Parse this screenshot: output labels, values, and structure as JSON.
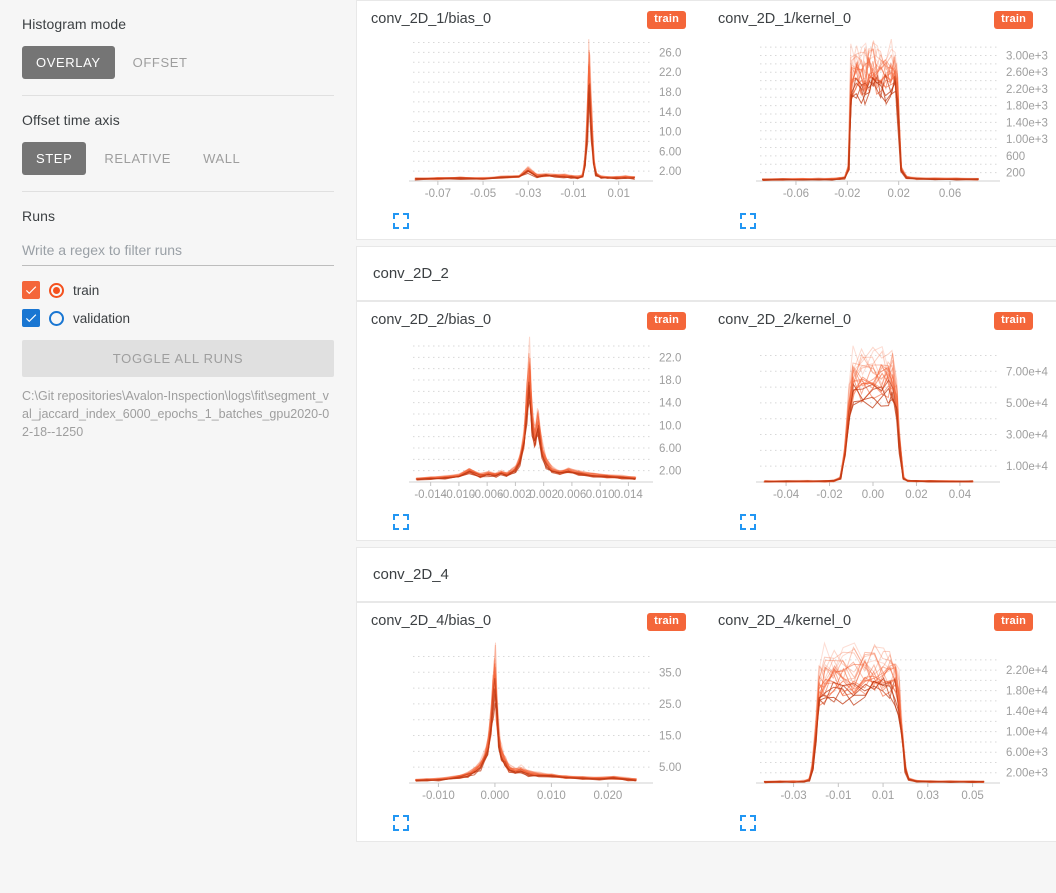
{
  "sidebar": {
    "histogram_mode": {
      "label": "Histogram mode",
      "options": [
        "OVERLAY",
        "OFFSET"
      ],
      "selected": "OVERLAY"
    },
    "offset_time_axis": {
      "label": "Offset time axis",
      "options": [
        "STEP",
        "RELATIVE",
        "WALL"
      ],
      "selected": "STEP"
    },
    "runs": {
      "label": "Runs",
      "filter_placeholder": "Write a regex to filter runs",
      "filter_value": "",
      "items": [
        {
          "name": "train",
          "checked": true,
          "color": "#f4663a",
          "selected": true
        },
        {
          "name": "validation",
          "checked": true,
          "color": "#1976d2",
          "selected": false
        }
      ],
      "toggle_all_label": "TOGGLE ALL RUNS",
      "logdir": "C:\\Git repositories\\Avalon-Inspection\\logs\\fit\\segment_val_jaccard_index_6000_epochs_1_batches_gpu2020-02-18--1250"
    }
  },
  "colors": {
    "accent_orange": "#f4663a",
    "accent_blue": "#1976d2",
    "active_button": "#757575",
    "grid": "#d8d8d8"
  },
  "main": {
    "groups": [
      {
        "header": null,
        "charts": [
          {
            "title": "conv_2D_1/bias_0",
            "badge": "train",
            "expand_icon": "fullscreen-icon",
            "chart_data": {
              "type": "line",
              "title": "conv_2D_1/bias_0",
              "xlabel": "",
              "ylabel": "",
              "grid": true,
              "legend": [
                "train"
              ],
              "xticks": [
                "-0.07",
                "-0.05",
                "-0.03",
                "-0.01",
                "0.01"
              ],
              "xtick_values": [
                -0.07,
                -0.05,
                -0.03,
                -0.01,
                0.01
              ],
              "yticks": [
                "2.00",
                "6.00",
                "10.0",
                "14.0",
                "18.0",
                "22.0",
                "26.0"
              ],
              "ytick_values": [
                2,
                6,
                10,
                14,
                18,
                22,
                26
              ],
              "xlim": [
                -0.081,
                0.019
              ],
              "ylim": [
                0,
                27.5
              ],
              "series": [
                {
                  "name": "train",
                  "x": [
                    -0.08,
                    -0.07,
                    -0.06,
                    -0.05,
                    -0.042,
                    -0.034,
                    -0.03,
                    -0.026,
                    -0.022,
                    -0.018,
                    -0.014,
                    -0.011,
                    -0.008,
                    -0.006,
                    -0.005,
                    -0.004,
                    -0.003,
                    -0.002,
                    -0.001,
                    0.0,
                    0.002,
                    0.005,
                    0.009,
                    0.013,
                    0.017
                  ],
                  "values": [
                    0.5,
                    0.6,
                    0.7,
                    0.6,
                    0.9,
                    1.1,
                    2.6,
                    1.2,
                    1.4,
                    1.3,
                    1.2,
                    1.0,
                    0.9,
                    1.2,
                    4.0,
                    12.0,
                    26.8,
                    13.0,
                    4.5,
                    1.6,
                    1.0,
                    0.9,
                    0.8,
                    0.9,
                    0.8
                  ]
                }
              ]
            }
          },
          {
            "title": "conv_2D_1/kernel_0",
            "badge": "train",
            "expand_icon": "fullscreen-icon",
            "chart_data": {
              "type": "line",
              "title": "conv_2D_1/kernel_0",
              "xlabel": "",
              "ylabel": "",
              "grid": true,
              "legend": [
                "train"
              ],
              "xticks": [
                "-0.06",
                "-0.02",
                "0.02",
                "0.06"
              ],
              "xtick_values": [
                -0.06,
                -0.02,
                0.02,
                0.06
              ],
              "yticks": [
                "200",
                "600",
                "1.00e+3",
                "1.40e+3",
                "1.80e+3",
                "2.20e+3",
                "2.60e+3",
                "3.00e+3"
              ],
              "ytick_values": [
                200,
                600,
                1000,
                1400,
                1800,
                2200,
                2600,
                3000
              ],
              "xlim": [
                -0.088,
                0.088
              ],
              "ylim": [
                0,
                3250
              ],
              "series": [
                {
                  "name": "train",
                  "x": [
                    -0.086,
                    -0.07,
                    -0.055,
                    -0.042,
                    -0.032,
                    -0.026,
                    -0.022,
                    -0.019,
                    -0.017,
                    -0.013,
                    -0.009,
                    -0.006,
                    -0.003,
                    0.0,
                    0.003,
                    0.006,
                    0.01,
                    0.014,
                    0.017,
                    0.019,
                    0.022,
                    0.026,
                    0.034,
                    0.048,
                    0.065,
                    0.082
                  ],
                  "values": [
                    40,
                    45,
                    50,
                    55,
                    60,
                    70,
                    90,
                    350,
                    2950,
                    3080,
                    2960,
                    2980,
                    3050,
                    3090,
                    3020,
                    2950,
                    2980,
                    3060,
                    3000,
                    2700,
                    330,
                    100,
                    70,
                    60,
                    55,
                    50
                  ]
                }
              ]
            }
          }
        ]
      },
      {
        "header": "conv_2D_2",
        "charts": [
          {
            "title": "conv_2D_2/bias_0",
            "badge": "train",
            "expand_icon": "fullscreen-icon",
            "chart_data": {
              "type": "line",
              "title": "conv_2D_2/bias_0",
              "xlabel": "",
              "ylabel": "",
              "grid": true,
              "legend": [
                "train"
              ],
              "xticks": [
                "-0.014",
                "-0.010",
                "-0.006",
                "-0.002",
                "0.002",
                "0.006",
                "0.010",
                "0.014"
              ],
              "xtick_values": [
                -0.014,
                -0.01,
                -0.006,
                -0.002,
                0.002,
                0.006,
                0.01,
                0.014
              ],
              "yticks": [
                "2.00",
                "6.00",
                "10.0",
                "14.0",
                "18.0",
                "22.0"
              ],
              "ytick_values": [
                2,
                6,
                10,
                14,
                18,
                22
              ],
              "xlim": [
                -0.0165,
                0.0155
              ],
              "ylim": [
                0,
                24
              ],
              "series": [
                {
                  "name": "train",
                  "x": [
                    -0.016,
                    -0.014,
                    -0.012,
                    -0.01,
                    -0.0085,
                    -0.007,
                    -0.0058,
                    -0.0048,
                    -0.004,
                    -0.0032,
                    -0.0026,
                    -0.002,
                    -0.0014,
                    -0.0008,
                    -0.0004,
                    0.0,
                    0.0004,
                    0.0008,
                    0.0012,
                    0.0018,
                    0.0024,
                    0.0032,
                    0.0042,
                    0.0055,
                    0.007,
                    0.009,
                    0.011,
                    0.013,
                    0.015
                  ],
                  "values": [
                    0.6,
                    0.8,
                    1.0,
                    1.3,
                    2.4,
                    1.4,
                    1.7,
                    1.5,
                    1.9,
                    1.6,
                    2.1,
                    2.6,
                    4.5,
                    9.0,
                    16.0,
                    23.0,
                    12.0,
                    9.5,
                    12.5,
                    6.5,
                    4.0,
                    2.6,
                    2.0,
                    2.4,
                    1.8,
                    1.4,
                    1.2,
                    1.0,
                    0.8
                  ]
                }
              ]
            }
          },
          {
            "title": "conv_2D_2/kernel_0",
            "badge": "train",
            "expand_icon": "fullscreen-icon",
            "chart_data": {
              "type": "line",
              "title": "conv_2D_2/kernel_0",
              "xlabel": "",
              "ylabel": "",
              "grid": true,
              "legend": [
                "train"
              ],
              "xticks": [
                "-0.04",
                "-0.02",
                "0.00",
                "0.02",
                "0.04"
              ],
              "xtick_values": [
                -0.04,
                -0.02,
                0.0,
                0.02,
                0.04
              ],
              "yticks": [
                "1.00e+4",
                "3.00e+4",
                "5.00e+4",
                "7.00e+4"
              ],
              "ytick_values": [
                10000,
                30000,
                50000,
                70000
              ],
              "xlim": [
                -0.052,
                0.052
              ],
              "ylim": [
                0,
                86000
              ],
              "series": [
                {
                  "name": "train",
                  "x": [
                    -0.05,
                    -0.04,
                    -0.03,
                    -0.022,
                    -0.018,
                    -0.015,
                    -0.013,
                    -0.011,
                    -0.009,
                    -0.005,
                    0.0,
                    0.004,
                    0.007,
                    0.009,
                    0.011,
                    0.012,
                    0.014,
                    0.016,
                    0.02,
                    0.026,
                    0.036,
                    0.046
                  ],
                  "values": [
                    400,
                    450,
                    500,
                    600,
                    900,
                    3000,
                    22000,
                    56000,
                    77500,
                    76500,
                    77000,
                    77500,
                    77000,
                    76500,
                    60000,
                    30000,
                    3000,
                    900,
                    600,
                    500,
                    450,
                    420
                  ]
                }
              ]
            }
          }
        ]
      },
      {
        "header": "conv_2D_4",
        "charts": [
          {
            "title": "conv_2D_4/bias_0",
            "badge": "train",
            "expand_icon": "fullscreen-icon",
            "chart_data": {
              "type": "line",
              "title": "conv_2D_4/bias_0",
              "xlabel": "",
              "ylabel": "",
              "grid": true,
              "legend": [
                "train"
              ],
              "xticks": [
                "-0.010",
                "0.000",
                "0.010",
                "0.020"
              ],
              "xtick_values": [
                -0.01,
                0.0,
                0.01,
                0.02
              ],
              "yticks": [
                "5.00",
                "15.0",
                "25.0",
                "35.0"
              ],
              "ytick_values": [
                5,
                15,
                25,
                35
              ],
              "xlim": [
                -0.0145,
                0.0255
              ],
              "ylim": [
                0,
                43
              ],
              "series": [
                {
                  "name": "train",
                  "x": [
                    -0.014,
                    -0.012,
                    -0.01,
                    -0.008,
                    -0.0062,
                    -0.0048,
                    -0.0036,
                    -0.0026,
                    -0.0018,
                    -0.0012,
                    -0.0007,
                    -0.0003,
                    0.0,
                    0.0003,
                    0.0007,
                    0.0012,
                    0.0018,
                    0.0026,
                    0.0036,
                    0.0046,
                    0.006,
                    0.0078,
                    0.01,
                    0.0125,
                    0.0155,
                    0.0185,
                    0.021,
                    0.0235,
                    0.025
                  ],
                  "values": [
                    1.0,
                    1.2,
                    1.4,
                    1.8,
                    2.4,
                    3.2,
                    4.5,
                    6.5,
                    9.5,
                    14.0,
                    22.0,
                    33.0,
                    41.0,
                    28.0,
                    16.0,
                    11.0,
                    8.0,
                    5.5,
                    4.5,
                    5.0,
                    3.6,
                    3.2,
                    2.8,
                    2.2,
                    1.8,
                    1.6,
                    2.0,
                    1.4,
                    1.2
                  ]
                }
              ]
            }
          },
          {
            "title": "conv_2D_4/kernel_0",
            "badge": "train",
            "expand_icon": "fullscreen-icon",
            "chart_data": {
              "type": "line",
              "title": "conv_2D_4/kernel_0",
              "xlabel": "",
              "ylabel": "",
              "grid": true,
              "legend": [
                "train"
              ],
              "xticks": [
                "-0.03",
                "-0.01",
                "0.01",
                "0.03",
                "0.05"
              ],
              "xtick_values": [
                -0.03,
                -0.01,
                0.01,
                0.03,
                0.05
              ],
              "yticks": [
                "2.00e+3",
                "6.00e+3",
                "1.00e+4",
                "1.40e+4",
                "1.80e+4",
                "2.20e+4"
              ],
              "ytick_values": [
                2000,
                6000,
                10000,
                14000,
                18000,
                22000
              ],
              "xlim": [
                -0.045,
                0.056
              ],
              "ylim": [
                0,
                26500
              ],
              "series": [
                {
                  "name": "train",
                  "x": [
                    -0.043,
                    -0.036,
                    -0.03,
                    -0.0255,
                    -0.023,
                    -0.0215,
                    -0.02,
                    -0.0185,
                    -0.016,
                    -0.012,
                    -0.008,
                    -0.003,
                    0.002,
                    0.006,
                    0.01,
                    0.013,
                    0.0155,
                    0.017,
                    0.0185,
                    0.02,
                    0.0215,
                    0.025,
                    0.031,
                    0.04,
                    0.05,
                    0.055
                  ],
                  "values": [
                    250,
                    280,
                    320,
                    400,
                    800,
                    3500,
                    12000,
                    21000,
                    24500,
                    24600,
                    24500,
                    24700,
                    24600,
                    24800,
                    24600,
                    24400,
                    23800,
                    20000,
                    11000,
                    3500,
                    900,
                    400,
                    330,
                    300,
                    280,
                    270
                  ]
                }
              ]
            }
          }
        ]
      }
    ]
  }
}
